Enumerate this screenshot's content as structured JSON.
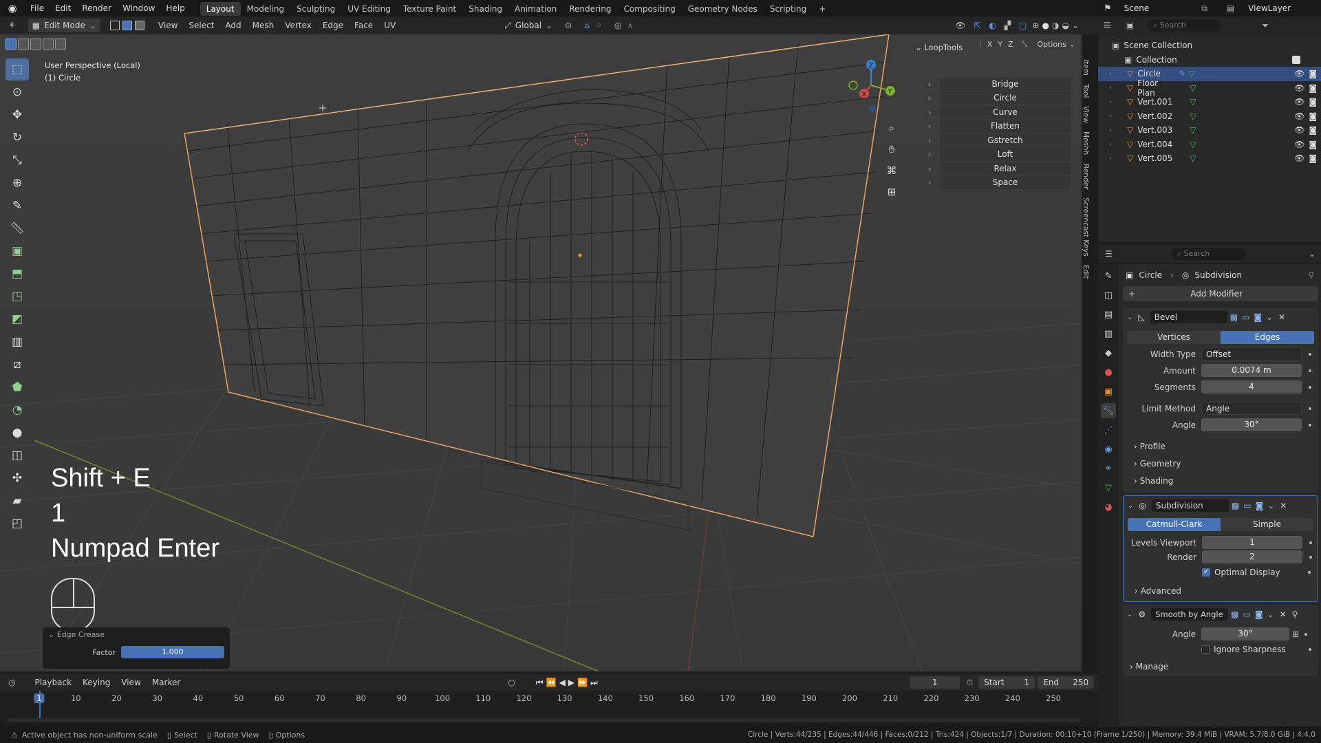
{
  "topmenu": {
    "items": [
      "File",
      "Edit",
      "Render",
      "Window",
      "Help"
    ]
  },
  "workspaces": [
    "Layout",
    "Modeling",
    "Sculpting",
    "UV Editing",
    "Texture Paint",
    "Shading",
    "Animation",
    "Rendering",
    "Compositing",
    "Geometry Nodes",
    "Scripting"
  ],
  "scene": {
    "label": "Scene",
    "viewlayer": "ViewLayer"
  },
  "viewport_header": {
    "mode": "Edit Mode",
    "menus": [
      "View",
      "Select",
      "Add",
      "Mesh",
      "Vertex",
      "Edge",
      "Face",
      "UV"
    ],
    "orientation": "Global",
    "options": "Options",
    "axes": [
      "X",
      "Y",
      "Z"
    ]
  },
  "viewport": {
    "perspective": "User Perspective (Local)",
    "object": "(1) Circle"
  },
  "keys": {
    "line1": "Shift + E",
    "line2": "1",
    "line3": "Numpad Enter"
  },
  "operator_panel": {
    "title": "Edge Crease",
    "factor_label": "Factor",
    "factor_value": "1.000"
  },
  "looptools": {
    "title": "LoopTools",
    "items": [
      "Bridge",
      "Circle",
      "Curve",
      "Flatten",
      "Gstretch",
      "Loft",
      "Relax",
      "Space"
    ]
  },
  "side_tabs": [
    "Item",
    "Tool",
    "View",
    "Meshh",
    "Render",
    "Screencast Keys",
    "Edit"
  ],
  "outliner": {
    "search_placeholder": "Search",
    "root": "Scene Collection",
    "collection": "Collection",
    "objects": [
      "Circle",
      "Floor Plan",
      "Vert.001",
      "Vert.002",
      "Vert.003",
      "Vert.004",
      "Vert.005"
    ]
  },
  "properties": {
    "search_placeholder": "Search",
    "breadcrumb_object": "Circle",
    "breadcrumb_modifier": "Subdivision",
    "add_modifier": "Add Modifier",
    "bevel": {
      "name": "Bevel",
      "tabs": [
        "Vertices",
        "Edges"
      ],
      "width_type_label": "Width Type",
      "width_type": "Offset",
      "amount_label": "Amount",
      "amount": "0.0074 m",
      "segments_label": "Segments",
      "segments": "4",
      "limit_method_label": "Limit Method",
      "limit_method": "Angle",
      "angle_label": "Angle",
      "angle": "30°",
      "sub": [
        "Profile",
        "Geometry",
        "Shading"
      ]
    },
    "subdivision": {
      "name": "Subdivision",
      "tabs": [
        "Catmull-Clark",
        "Simple"
      ],
      "levels_viewport_label": "Levels Viewport",
      "levels_viewport": "1",
      "render_label": "Render",
      "render": "2",
      "optimal_display": "Optimal Display",
      "advanced": "Advanced"
    },
    "smooth": {
      "name": "Smooth by Angle",
      "angle_label": "Angle",
      "angle": "30°",
      "ignore_sharpness": "Ignore Sharpness",
      "manage": "Manage"
    }
  },
  "timeline": {
    "menus": [
      "Playback",
      "Keying",
      "View",
      "Marker"
    ],
    "frame": "1",
    "start_label": "Start",
    "start": "1",
    "end_label": "End",
    "end": "250",
    "ticks": [
      "1",
      "10",
      "20",
      "30",
      "40",
      "50",
      "60",
      "70",
      "80",
      "90",
      "100",
      "110",
      "120",
      "130",
      "140",
      "150",
      "160",
      "170",
      "180",
      "190",
      "200",
      "210",
      "220",
      "230",
      "240",
      "250"
    ]
  },
  "statusbar": {
    "left": [
      "Active object has non-uniform scale",
      "Select",
      "Rotate View",
      "Options"
    ],
    "right": "Circle | Verts:44/235 | Edges:44/446 | Faces:0/212 | Tris:424 | Objects:1/7 | Duration: 00:10+10 (Frame 1/250) | Memory: 39.4 MiB | VRAM: 5.7/8.0 GiB | 4.4.0"
  },
  "colors": {
    "accent": "#4772b3",
    "selection": "#f0a35e",
    "active_object": "#ffaf29"
  }
}
